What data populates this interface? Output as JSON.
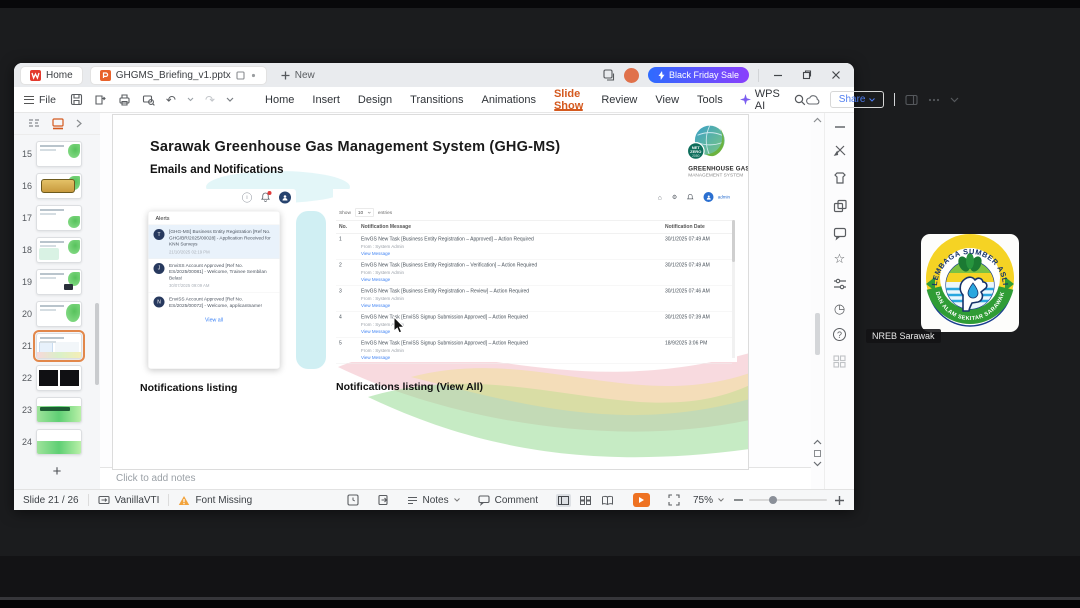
{
  "app": {
    "tab_home": "Home",
    "doc_tab": "GHGMS_Briefing_v1.pptx",
    "new_tab": "New",
    "promo": "Black Friday Sale",
    "file_menu": "File",
    "menus": [
      "Home",
      "Insert",
      "Design",
      "Transitions",
      "Animations",
      "Slide Show",
      "Review",
      "View",
      "Tools"
    ],
    "wps_ai": "WPS AI",
    "share": "Share",
    "notes_placeholder": "Click to add notes",
    "status": {
      "slide_counter": "Slide 21 / 26",
      "theme": "VanillaVTI",
      "font_warning": "Font Missing",
      "notes": "Notes",
      "comment": "Comment",
      "zoom": "75%"
    }
  },
  "panel": {
    "slides": [
      "15",
      "16",
      "17",
      "18",
      "19",
      "20",
      "21",
      "22",
      "23",
      "24"
    ],
    "add": "+"
  },
  "slide": {
    "title": "Sarawak Greenhouse Gas Management System (GHG-MS)",
    "subtitle": "Emails and Notifications",
    "logo": {
      "badge": {
        "l1": "NET",
        "l2": "ZERO",
        "l3": "2050"
      },
      "line1": "GREENHOUSE GAS",
      "line2": "MANAGEMENT SYSTEM"
    },
    "caption_left": "Notifications listing",
    "caption_right": "Notifications listing (View All)",
    "alerts": {
      "header": "Alerts",
      "items": [
        {
          "initial": "T",
          "text": "[GHG-MS] Business Entity Registration [Ref No. GHG/BR/2025/00028] - Application Received for KNN Surveys",
          "date": "21/10/2025 02:19 PM"
        },
        {
          "initial": "J",
          "text": "EnviSS Account Approved [Ref No. ES/2025/00081] - Welcome, Trainee Sembilan Belas!",
          "date": "30/07/2025 09:09 AM"
        },
        {
          "initial": "N",
          "text": "EnviSS Account Approved [Ref No. ES/2025/00072] - Welcome, applicantname!",
          "date": ""
        }
      ],
      "view_all": "View all"
    },
    "portal": {
      "admin": "admin",
      "show": "Show",
      "show_value": "10",
      "entries": "entries",
      "headers": {
        "no": "No.",
        "message": "Notification Message",
        "date": "Notification Date"
      },
      "rows": [
        {
          "no": "1",
          "message": "EnvGS New Task [Business Entity Registration – Approved] – Action Required",
          "from": "From : System Admin",
          "link": "View Message",
          "date": "30/1/2025 07:49 AM"
        },
        {
          "no": "2",
          "message": "EnvGS New Task [Business Entity Registration – Verification] – Action Required",
          "from": "From : System Admin",
          "link": "View Message",
          "date": "30/1/2025 07:49 AM"
        },
        {
          "no": "3",
          "message": "EnvGS New Task [Business Entity Registration – Review] – Action Required",
          "from": "From : System Admin",
          "link": "View Message",
          "date": "30/1/2025 07:46 AM"
        },
        {
          "no": "4",
          "message": "EnvGS New Task [EnviSS Signup Submission Approved] – Action Required",
          "from": "From : System Admin",
          "link": "View Message",
          "date": "30/1/2025 07:39 AM"
        },
        {
          "no": "5",
          "message": "EnvGS New Task [EnviSS Signup Submission Approved] – Action Required",
          "from": "From : System Admin",
          "link": "View Message",
          "date": "18/9/2025 3:06 PM"
        }
      ]
    }
  },
  "participant": {
    "name": "NREB Sarawak",
    "seal_top": "LEMBAGA SUMBER ASLI",
    "seal_bottom": "DAN ALAM SEKITAR SARAWAK"
  }
}
